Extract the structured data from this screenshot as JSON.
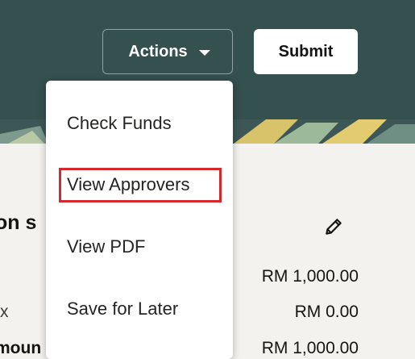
{
  "header": {
    "actions_label": "Actions",
    "submit_label": "Submit",
    "background_color": "#34504f"
  },
  "section": {
    "title": "on s",
    "rows": [
      {
        "label": "",
        "value": "RM 1,000.00"
      },
      {
        "label": "x",
        "value": "RM 0.00"
      },
      {
        "label": "moun",
        "value": "RM 1,000.00"
      }
    ]
  },
  "menu": {
    "items": [
      {
        "label": "Check Funds"
      },
      {
        "label": "View Approvers",
        "highlighted": true
      },
      {
        "label": "View PDF"
      },
      {
        "label": "Save for Later"
      }
    ],
    "highlight_color": "#d4292c"
  }
}
